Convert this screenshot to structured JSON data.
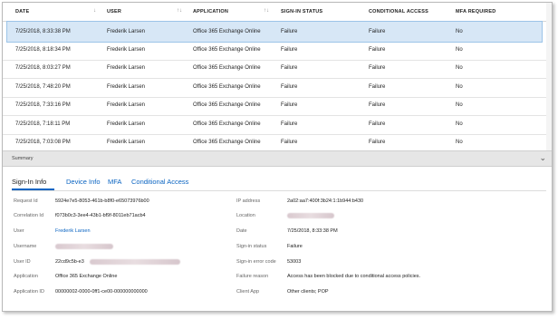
{
  "columns": [
    {
      "label": "DATE",
      "sort": "↓"
    },
    {
      "label": "USER",
      "sort": "↑↓"
    },
    {
      "label": "APPLICATION",
      "sort": "↑↓"
    },
    {
      "label": "SIGN-IN STATUS",
      "sort": ""
    },
    {
      "label": "CONDITIONAL ACCESS",
      "sort": ""
    },
    {
      "label": "MFA REQUIRED",
      "sort": ""
    }
  ],
  "rows": [
    [
      "7/25/2018, 8:33:38 PM",
      "Frederik Larsen",
      "Office 365 Exchange Online",
      "Failure",
      "Failure",
      "No"
    ],
    [
      "7/25/2018, 8:18:34 PM",
      "Frederik Larsen",
      "Office 365 Exchange Online",
      "Failure",
      "Failure",
      "No"
    ],
    [
      "7/25/2018, 8:03:27 PM",
      "Frederik Larsen",
      "Office 365 Exchange Online",
      "Failure",
      "Failure",
      "No"
    ],
    [
      "7/25/2018, 7:48:20 PM",
      "Frederik Larsen",
      "Office 365 Exchange Online",
      "Failure",
      "Failure",
      "No"
    ],
    [
      "7/25/2018, 7:33:16 PM",
      "Frederik Larsen",
      "Office 365 Exchange Online",
      "Failure",
      "Failure",
      "No"
    ],
    [
      "7/25/2018, 7:18:11 PM",
      "Frederik Larsen",
      "Office 365 Exchange Online",
      "Failure",
      "Failure",
      "No"
    ],
    [
      "7/25/2018, 7:03:08 PM",
      "Frederik Larsen",
      "Office 365 Exchange Online",
      "Failure",
      "Failure",
      "No"
    ]
  ],
  "summary": {
    "label": "Summary",
    "chevron_icon": "chevron-down-icon"
  },
  "tabs": [
    "Sign-In Info",
    "Device Info",
    "MFA",
    "Conditional Access"
  ],
  "details_left": [
    {
      "label": "Request Id",
      "value": "5924e7e5-8053-461b-b8f0-e65073976b00"
    },
    {
      "label": "Correlation Id",
      "value": "f073b0c3-3ee4-43b1-bf9f-8011eb71acb4"
    },
    {
      "label": "User",
      "value": "Frederik Larsen"
    },
    {
      "label": "Username",
      "value": ""
    },
    {
      "label": "User ID",
      "value": "22cd9c5b-e3"
    },
    {
      "label": "Application",
      "value": "Office 365 Exchange Online"
    },
    {
      "label": "Application ID",
      "value": "00000002-0000-0ff1-ce00-000000000000"
    }
  ],
  "details_right": [
    {
      "label": "IP address",
      "value": "2a02:aa7:400f:3b24:1:1b944:b430"
    },
    {
      "label": "Location",
      "value": ""
    },
    {
      "label": "Date",
      "value": "7/25/2018, 8:33:38 PM"
    },
    {
      "label": "Sign-in status",
      "value": "Failure"
    },
    {
      "label": "Sign-in error code",
      "value": "53003"
    },
    {
      "label": "Failure reason",
      "value": "Access has been blocked due to conditional access policies."
    },
    {
      "label": "Client App",
      "value": "Other clients; POP"
    }
  ]
}
